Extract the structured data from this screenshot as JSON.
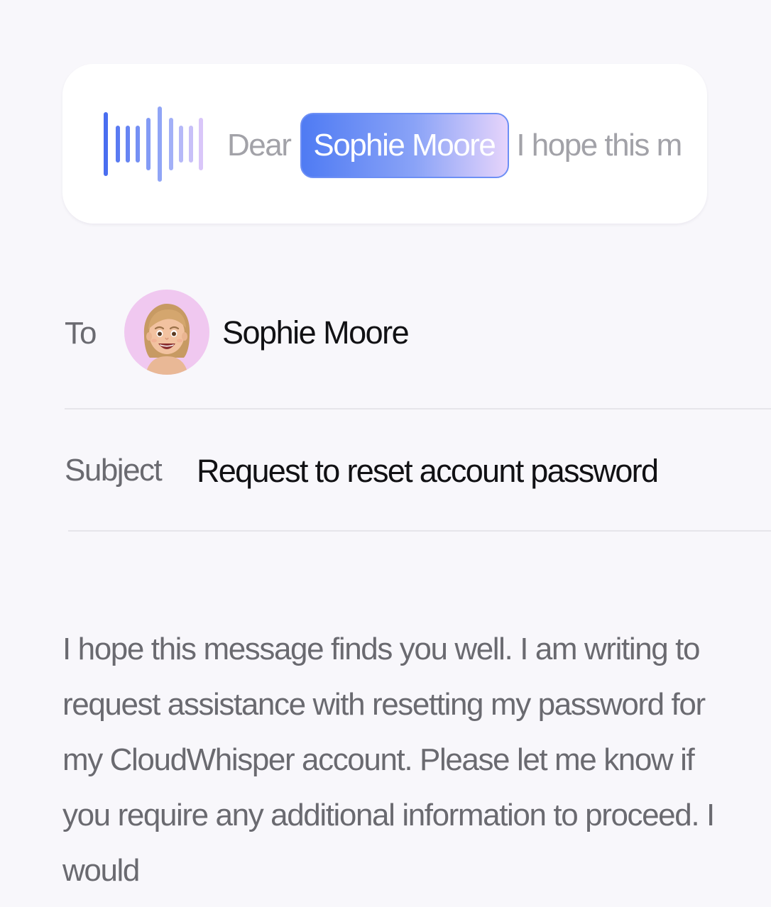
{
  "voice_card": {
    "word_before": "Dear",
    "highlighted_name": "Sophie Moore",
    "text_after": "I hope this m"
  },
  "recipient": {
    "label": "To",
    "name": "Sophie Moore",
    "avatar_icon": "memoji-avatar-icon",
    "avatar_bg": "#f0c8f0"
  },
  "subject": {
    "label": "Subject",
    "value": "Request to reset account password"
  },
  "body": {
    "text": "I hope this message finds you well. I am writing to request assistance with resetting my password for my CloudWhisper account. Please let me know if you require any additional information to proceed. I would"
  },
  "colors": {
    "accent_blue": "#4f7bf3",
    "accent_lavender": "#e6d4fb",
    "background": "#f8f7fb"
  }
}
